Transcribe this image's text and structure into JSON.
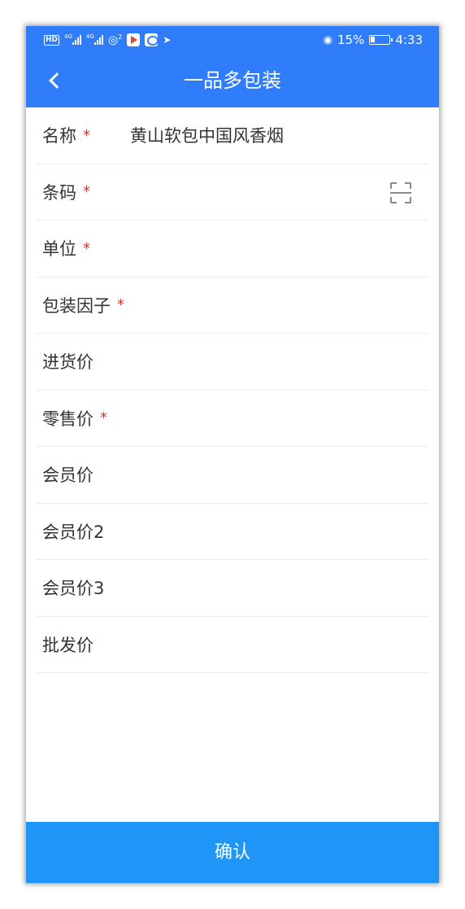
{
  "status_bar": {
    "network": "HD",
    "signal1_tag": "4G",
    "signal2_tag": "4G",
    "wifi_badge": "2",
    "battery": "15%",
    "time": "4:33",
    "icons": [
      "hd-icon",
      "signal-icon",
      "signal-icon",
      "wifi-icon",
      "video-app-icon",
      "camera-app-icon",
      "location-pin-icon",
      "eye-icon",
      "battery-icon"
    ]
  },
  "header": {
    "title": "一品多包装",
    "back_icon": "chevron-left-icon"
  },
  "form": {
    "fields": [
      {
        "label": "名称",
        "required": "*",
        "value": "黄山软包中国风香烟"
      },
      {
        "label": "条码",
        "required": "*",
        "value": "",
        "icon": "scan-icon"
      },
      {
        "label": "单位",
        "required": "*",
        "value": ""
      },
      {
        "label": "包装因子",
        "required": "*",
        "value": ""
      },
      {
        "label": "进货价",
        "required": "",
        "value": ""
      },
      {
        "label": "零售价",
        "required": "*",
        "value": ""
      },
      {
        "label": "会员价",
        "required": "",
        "value": ""
      },
      {
        "label": "会员价2",
        "required": "",
        "value": ""
      },
      {
        "label": "会员价3",
        "required": "",
        "value": ""
      },
      {
        "label": "批发价",
        "required": "",
        "value": ""
      }
    ]
  },
  "footer": {
    "confirm_label": "确认"
  },
  "colors": {
    "primary": "#2f7dfa",
    "confirm": "#1e95f7",
    "required": "#d9372b",
    "divider": "#ececec"
  }
}
